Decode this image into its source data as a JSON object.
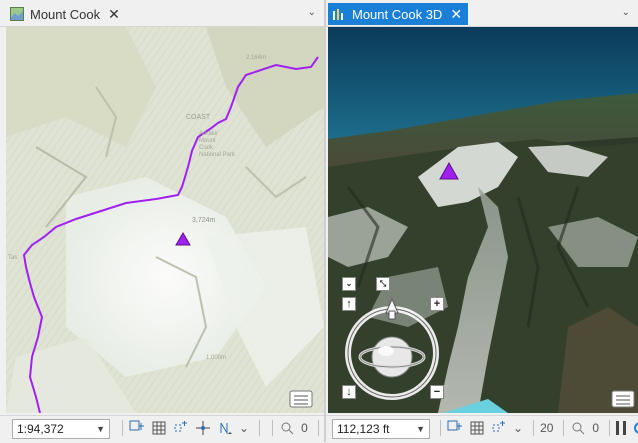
{
  "left_pane": {
    "tab_title": "Mount Cook",
    "tab_icon": "map-icon",
    "scale": "1:94,372",
    "snapping_count": "0",
    "map_labels": {
      "coast": "COAST",
      "park_line1": "Aoraki/",
      "park_line2": "Mount",
      "park_line3": "Cook",
      "park_line4": "National Park",
      "hut": "2,164m",
      "left_edge": "Tas",
      "peak": "3,724m",
      "bottom_label": "1,000m"
    }
  },
  "right_pane": {
    "tab_title": "Mount Cook 3D",
    "tab_icon": "scene-icon",
    "scale": "112,123 ft",
    "partial_value": "20",
    "snapping_count": "0"
  },
  "colors": {
    "active_tab": "#1a7fd6",
    "boundary_line": "#a020f0",
    "peak_marker": "#a020f0"
  }
}
